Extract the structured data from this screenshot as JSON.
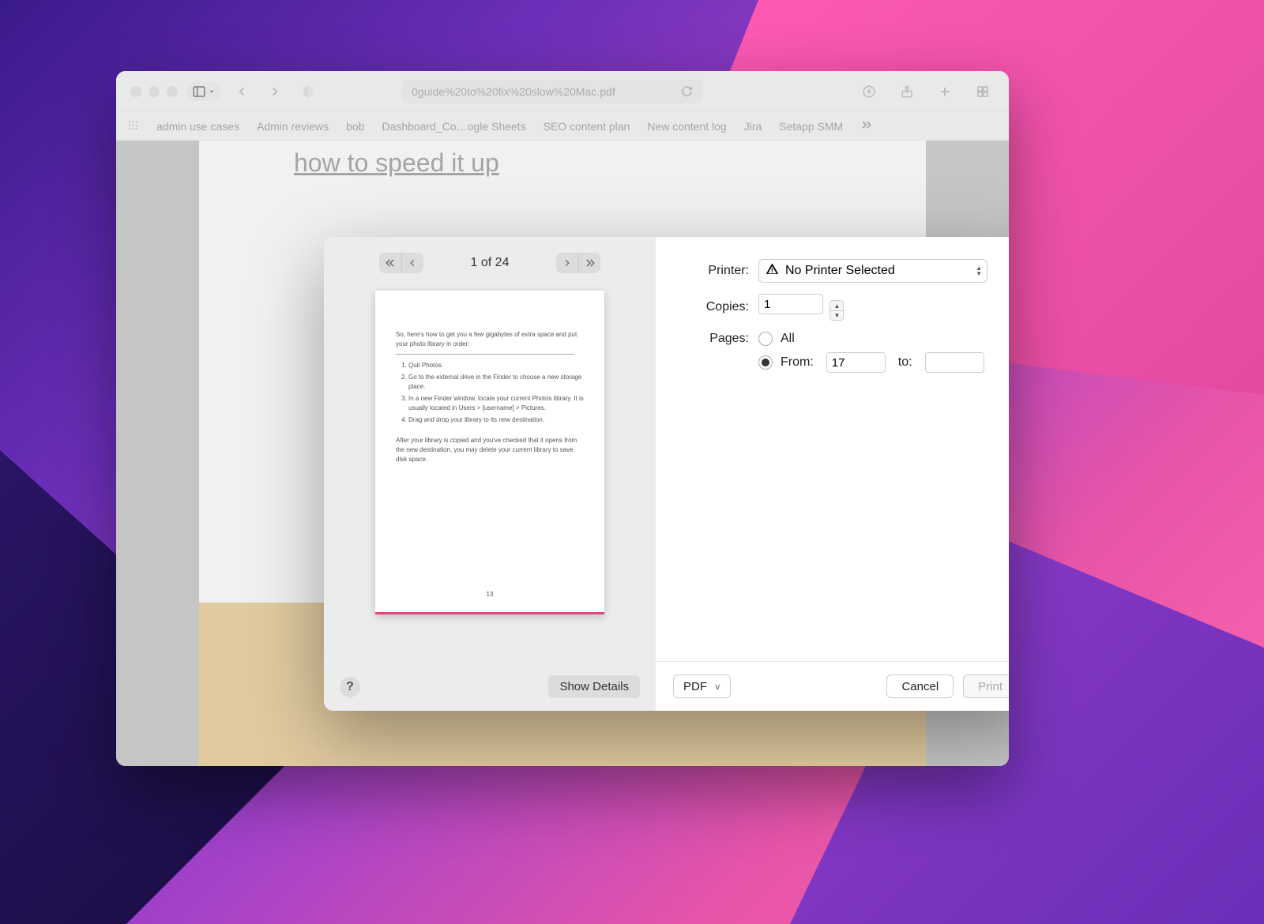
{
  "browser": {
    "url_display": "0guide%20to%20fix%20slow%20Mac.pdf",
    "bookmarks": [
      "admin use cases",
      "Admin reviews",
      "bob",
      "Dashboard_Co…ogle Sheets",
      "SEO content plan",
      "New content log",
      "Jira",
      "Setapp SMM"
    ],
    "visible_heading": "how to speed it up"
  },
  "print": {
    "pager_label": "1 of 24",
    "printer_label": "Printer:",
    "printer_value": "No Printer Selected",
    "copies_label": "Copies:",
    "copies_value": "1",
    "pages_label": "Pages:",
    "all_label": "All",
    "from_label": "From:",
    "from_value": "17",
    "to_label": "to:",
    "to_value": "",
    "help_label": "?",
    "show_details_label": "Show Details",
    "pdf_label": "PDF",
    "cancel_label": "Cancel",
    "print_label": "Print",
    "pages_mode": "from"
  },
  "preview": {
    "intro": "So, here's how to get you a few gigabytes of extra space and put your photo library in order:",
    "steps": [
      "Quit Photos.",
      "Go to the external drive in the Finder to choose a new storage place.",
      "In a new Finder window, locate your current Photos library. It is usually located in Users > [username] > Pictures.",
      "Drag and drop your library to its new destination."
    ],
    "outro": "After your library is copied and you've checked that it opens from the new destination, you may delete your current library to save disk space.",
    "page_number": "13"
  }
}
